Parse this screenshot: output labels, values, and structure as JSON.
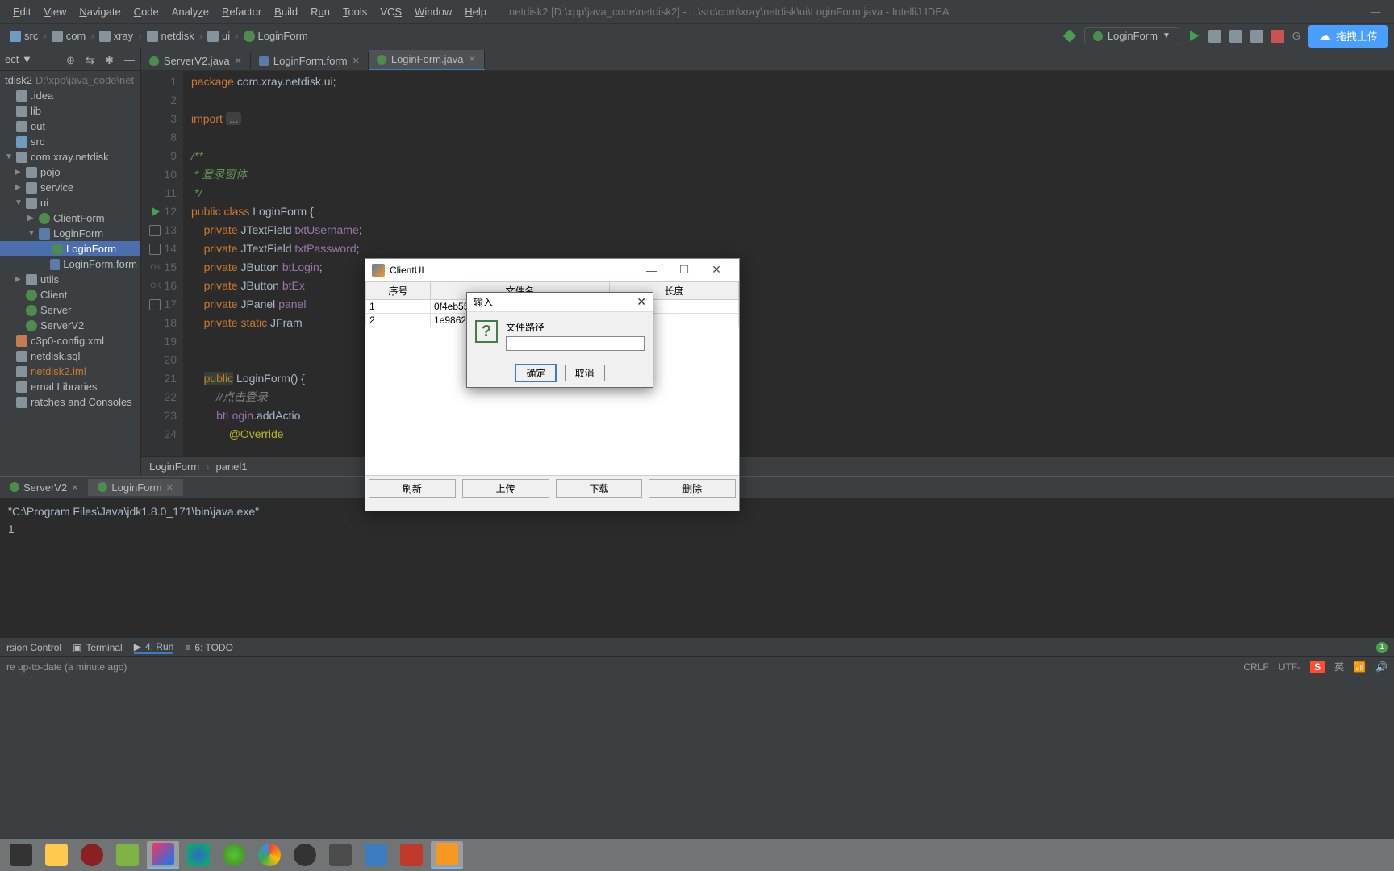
{
  "window_title": "netdisk2 [D:\\xpp\\java_code\\netdisk2] - ...\\src\\com\\xray\\netdisk\\ui\\LoginForm.java - IntelliJ IDEA",
  "menu": [
    "Edit",
    "View",
    "Navigate",
    "Code",
    "Analyze",
    "Refactor",
    "Build",
    "Run",
    "Tools",
    "VCS",
    "Window",
    "Help"
  ],
  "breadcrumb": [
    "src",
    "com",
    "xray",
    "netdisk",
    "ui",
    "LoginForm"
  ],
  "run_config": "LoginForm",
  "upload_button": "拖拽上传",
  "project_root": {
    "name": "tdisk2",
    "path": "D:\\xpp\\java_code\\net"
  },
  "tree": [
    {
      "label": ".idea",
      "indent": 0,
      "icon": "folder"
    },
    {
      "label": "lib",
      "indent": 0,
      "icon": "folder"
    },
    {
      "label": "out",
      "indent": 0,
      "icon": "folder"
    },
    {
      "label": "src",
      "indent": 0,
      "icon": "moddir"
    },
    {
      "label": "com.xray.netdisk",
      "indent": 0,
      "icon": "folder",
      "arrow": "▼"
    },
    {
      "label": "pojo",
      "indent": 1,
      "icon": "folder",
      "arrow": "▶"
    },
    {
      "label": "service",
      "indent": 1,
      "icon": "folder",
      "arrow": "▶"
    },
    {
      "label": "ui",
      "indent": 1,
      "icon": "folder",
      "arrow": "▼"
    },
    {
      "label": "ClientForm",
      "indent": 2,
      "icon": "class",
      "arrow": "▶"
    },
    {
      "label": "LoginForm",
      "indent": 2,
      "icon": "form",
      "arrow": "▼"
    },
    {
      "label": "LoginForm",
      "indent": 3,
      "icon": "class",
      "selected": true
    },
    {
      "label": "LoginForm.form",
      "indent": 3,
      "icon": "form"
    },
    {
      "label": "utils",
      "indent": 1,
      "icon": "folder",
      "arrow": "▶"
    },
    {
      "label": "Client",
      "indent": 1,
      "icon": "class"
    },
    {
      "label": "Server",
      "indent": 1,
      "icon": "class"
    },
    {
      "label": "ServerV2",
      "indent": 1,
      "icon": "class"
    },
    {
      "label": "c3p0-config.xml",
      "indent": 0,
      "icon": "xml"
    },
    {
      "label": "netdisk.sql",
      "indent": 0,
      "icon": "file"
    },
    {
      "label": "netdisk2.iml",
      "indent": 0,
      "icon": "file",
      "orange": true
    },
    {
      "label": "ernal Libraries",
      "indent": 0,
      "icon": "folder"
    },
    {
      "label": "ratches and Consoles",
      "indent": 0,
      "icon": "folder"
    }
  ],
  "editor_tabs": [
    {
      "label": "ServerV2.java",
      "icon": "class"
    },
    {
      "label": "LoginForm.form",
      "icon": "form"
    },
    {
      "label": "LoginForm.java",
      "icon": "class",
      "active": true
    }
  ],
  "code_lines": [
    {
      "n": 1,
      "html": "<span class='kw'>package</span> com.xray.netdisk.ui;"
    },
    {
      "n": 2,
      "html": ""
    },
    {
      "n": 3,
      "html": "<span class='kw'>import</span> <span class='dots'>...</span>"
    },
    {
      "n": 8,
      "html": ""
    },
    {
      "n": 9,
      "html": "<span class='comment-doc'>/**</span>"
    },
    {
      "n": 10,
      "html": "<span class='comment-doc'> * 登录窗体</span>"
    },
    {
      "n": 11,
      "html": "<span class='comment-doc'> */</span>"
    },
    {
      "n": 12,
      "html": "<span class='kw'>public class</span> LoginForm {",
      "gutter": "run"
    },
    {
      "n": 13,
      "html": "    <span class='kw'>private</span> JTextField <span class='field'>txtUsername</span>;",
      "gutter": "impl"
    },
    {
      "n": 14,
      "html": "    <span class='kw'>private</span> JTextField <span class='field'>txtPassword</span>;",
      "gutter": "impl"
    },
    {
      "n": 15,
      "html": "    <span class='kw'>private</span> JButton <span class='field'>btLogin</span>;",
      "gutter": "ok"
    },
    {
      "n": 16,
      "html": "    <span class='kw'>private</span> JButton <span class='field'>btEx</span>",
      "gutter": "ok"
    },
    {
      "n": 17,
      "html": "    <span class='kw'>private</span> JPanel <span class='field'>panel</span>",
      "gutter": "box"
    },
    {
      "n": 18,
      "html": "    <span class='kw'>private static</span> JFram"
    },
    {
      "n": 19,
      "html": ""
    },
    {
      "n": 20,
      "html": ""
    },
    {
      "n": 21,
      "html": "    <span class='kw' style='background:#344134'>public</span> LoginForm() {"
    },
    {
      "n": 22,
      "html": "        <span class='comment'>//点击登录</span>"
    },
    {
      "n": 23,
      "html": "        <span class='field'>btLogin</span>.addActio"
    },
    {
      "n": 24,
      "html": "            <span style='color:#bbb529'>@Override</span>"
    }
  ],
  "breadcrumb_bottom": [
    "LoginForm",
    "panel1"
  ],
  "run_tabs": [
    {
      "label": "ServerV2"
    },
    {
      "label": "LoginForm",
      "active": true
    }
  ],
  "console_lines": [
    "\"C:\\Program Files\\Java\\jdk1.8.0_171\\bin\\java.exe\"",
    "1"
  ],
  "bottom_tools": {
    "vc": "rsion Control",
    "terminal": "Terminal",
    "run": "4: Run",
    "todo": "6: TODO"
  },
  "status_left": "re up-to-date (a minute ago)",
  "status_right": {
    "crlf": "CRLF",
    "enc": "UTF-",
    "ime": "S",
    "ime2": "英"
  },
  "client_ui": {
    "title": "ClientUI",
    "headers": [
      "序号",
      "文件名",
      "长度"
    ],
    "rows": [
      [
        "1",
        "0f4eb55",
        ""
      ],
      [
        "2",
        "1e98620",
        ""
      ]
    ],
    "buttons": [
      "刷新",
      "上传",
      "下载",
      "删除"
    ]
  },
  "input_dialog": {
    "title": "输入",
    "label": "文件路径",
    "ok": "确定",
    "cancel": "取消"
  }
}
